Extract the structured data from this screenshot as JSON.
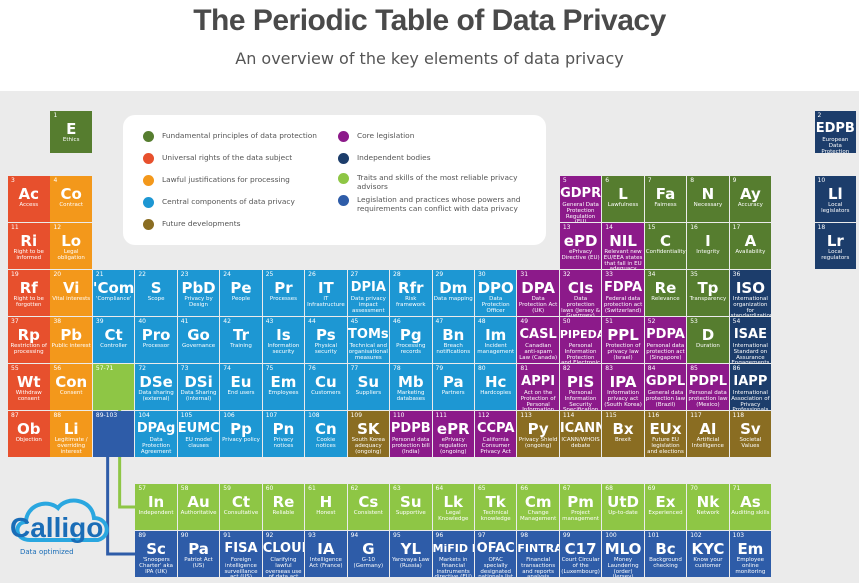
{
  "title": "The Periodic Table of Data Privacy",
  "subtitle": "An overview of the key elements of data privacy",
  "colors": {
    "fundamental": "#567d2f",
    "rights": "#e7502d",
    "lawful": "#f3981b",
    "central": "#1d97d3",
    "future": "#8a6d22",
    "core_legislation": "#8c1a8a",
    "independent_bodies": "#1c3d6b",
    "traits": "#8ec645",
    "conflicting": "#2e5ca8",
    "placeholder_lanthanide": "#8ec645",
    "placeholder_actinide": "#2e5ca8"
  },
  "legend": [
    {
      "key": "fundamental",
      "label": "Fundamental principles of data protection"
    },
    {
      "key": "rights",
      "label": "Universal rights of the data subject"
    },
    {
      "key": "lawful",
      "label": "Lawful justifications for processing"
    },
    {
      "key": "central",
      "label": "Central components of data privacy"
    },
    {
      "key": "future",
      "label": "Future developments"
    },
    {
      "key": "core_legislation",
      "label": "Core legislation"
    },
    {
      "key": "independent_bodies",
      "label": "Independent bodies"
    },
    {
      "key": "traits",
      "label": "Traits and skills of the most reliable privacy advisors"
    },
    {
      "key": "conflicting",
      "label": "Legislation and practices whose powers and requirements can conflict with data privacy"
    }
  ],
  "elements": [
    {
      "n": "1",
      "s": "E",
      "d": "Ethics",
      "c": "fundamental",
      "row": 0,
      "col": 1
    },
    {
      "n": "2",
      "s": "EDPB",
      "d": "European Data Protection Board",
      "c": "independent_bodies",
      "row": 0,
      "col": 19
    },
    {
      "n": "3",
      "s": "Ac",
      "d": "Access",
      "c": "rights",
      "row": 1,
      "col": 0
    },
    {
      "n": "4",
      "s": "Co",
      "d": "Contract",
      "c": "lawful",
      "row": 1,
      "col": 1
    },
    {
      "n": "5",
      "s": "GDPR",
      "d": "General Data Protection Regulation (EU)",
      "c": "core_legislation",
      "row": 1,
      "col": 13
    },
    {
      "n": "6",
      "s": "L",
      "d": "Lawfulness",
      "c": "fundamental",
      "row": 1,
      "col": 14
    },
    {
      "n": "7",
      "s": "Fa",
      "d": "Fairness",
      "c": "fundamental",
      "row": 1,
      "col": 15
    },
    {
      "n": "8",
      "s": "N",
      "d": "Necessary",
      "c": "fundamental",
      "row": 1,
      "col": 16
    },
    {
      "n": "9",
      "s": "Ay",
      "d": "Accuracy",
      "c": "fundamental",
      "row": 1,
      "col": 17
    },
    {
      "n": "10",
      "s": "Ll",
      "d": "Local legislators",
      "c": "independent_bodies",
      "row": 1,
      "col": 19
    },
    {
      "n": "11",
      "s": "Ri",
      "d": "Right to be informed",
      "c": "rights",
      "row": 2,
      "col": 0
    },
    {
      "n": "12",
      "s": "Lo",
      "d": "Legal obligation",
      "c": "lawful",
      "row": 2,
      "col": 1
    },
    {
      "n": "13",
      "s": "ePD",
      "d": "ePrivacy Directive (EU)",
      "c": "core_legislation",
      "row": 2,
      "col": 13
    },
    {
      "n": "14",
      "s": "NIL",
      "d": "Relevant new EU/EEA states that fall in EU adequacy (Norway, Iceland, Liechtenstein)",
      "c": "core_legislation",
      "row": 2,
      "col": 14
    },
    {
      "n": "15",
      "s": "C",
      "d": "Confidentiality",
      "c": "fundamental",
      "row": 2,
      "col": 15
    },
    {
      "n": "16",
      "s": "I",
      "d": "Integrity",
      "c": "fundamental",
      "row": 2,
      "col": 16
    },
    {
      "n": "17",
      "s": "A",
      "d": "Availability",
      "c": "fundamental",
      "row": 2,
      "col": 17
    },
    {
      "n": "18",
      "s": "Lr",
      "d": "Local regulators",
      "c": "independent_bodies",
      "row": 2,
      "col": 19
    },
    {
      "n": "19",
      "s": "Rf",
      "d": "Right to be forgotten",
      "c": "rights",
      "row": 3,
      "col": 0
    },
    {
      "n": "20",
      "s": "Vi",
      "d": "Vital interests",
      "c": "lawful",
      "row": 3,
      "col": 1
    },
    {
      "n": "21",
      "s": "'Com'",
      "d": "'Compliance'",
      "c": "central",
      "row": 3,
      "col": 2
    },
    {
      "n": "22",
      "s": "S",
      "d": "Scope",
      "c": "central",
      "row": 3,
      "col": 3
    },
    {
      "n": "23",
      "s": "PbD",
      "d": "Privacy by Design",
      "c": "central",
      "row": 3,
      "col": 4
    },
    {
      "n": "24",
      "s": "Pe",
      "d": "People",
      "c": "central",
      "row": 3,
      "col": 5
    },
    {
      "n": "25",
      "s": "Pr",
      "d": "Processes",
      "c": "central",
      "row": 3,
      "col": 6
    },
    {
      "n": "26",
      "s": "IT",
      "d": "IT Infrastructure",
      "c": "central",
      "row": 3,
      "col": 7
    },
    {
      "n": "27",
      "s": "DPIA",
      "d": "Data privacy impact assessment",
      "c": "central",
      "row": 3,
      "col": 8
    },
    {
      "n": "28",
      "s": "Rfr",
      "d": "Risk framework",
      "c": "central",
      "row": 3,
      "col": 9
    },
    {
      "n": "29",
      "s": "Dm",
      "d": "Data mapping",
      "c": "central",
      "row": 3,
      "col": 10
    },
    {
      "n": "30",
      "s": "DPO",
      "d": "Data Protection Officer",
      "c": "central",
      "row": 3,
      "col": 11
    },
    {
      "n": "31",
      "s": "DPA",
      "d": "Data Protection Act (UK)",
      "c": "core_legislation",
      "row": 3,
      "col": 12
    },
    {
      "n": "32",
      "s": "CIs",
      "d": "Data protection laws (Jersey & Guernsey)",
      "c": "core_legislation",
      "row": 3,
      "col": 13
    },
    {
      "n": "33",
      "s": "FDPA",
      "d": "Federal data protection act (Switzerland)",
      "c": "core_legislation",
      "row": 3,
      "col": 14
    },
    {
      "n": "34",
      "s": "Re",
      "d": "Relevance",
      "c": "fundamental",
      "row": 3,
      "col": 15
    },
    {
      "n": "35",
      "s": "Tp",
      "d": "Transparency",
      "c": "fundamental",
      "row": 3,
      "col": 16
    },
    {
      "n": "36",
      "s": "ISO",
      "d": "International organization for standardization",
      "c": "independent_bodies",
      "row": 3,
      "col": 17
    },
    {
      "n": "37",
      "s": "Rp",
      "d": "Restriction of processing",
      "c": "rights",
      "row": 4,
      "col": 0
    },
    {
      "n": "38",
      "s": "Pb",
      "d": "Public interest",
      "c": "lawful",
      "row": 4,
      "col": 1
    },
    {
      "n": "39",
      "s": "Ct",
      "d": "Controller",
      "c": "central",
      "row": 4,
      "col": 2
    },
    {
      "n": "40",
      "s": "Pro",
      "d": "Processor",
      "c": "central",
      "row": 4,
      "col": 3
    },
    {
      "n": "41",
      "s": "Go",
      "d": "Governance",
      "c": "central",
      "row": 4,
      "col": 4
    },
    {
      "n": "42",
      "s": "Tr",
      "d": "Training",
      "c": "central",
      "row": 4,
      "col": 5
    },
    {
      "n": "43",
      "s": "Is",
      "d": "Information security",
      "c": "central",
      "row": 4,
      "col": 6
    },
    {
      "n": "44",
      "s": "Ps",
      "d": "Physical security",
      "c": "central",
      "row": 4,
      "col": 7
    },
    {
      "n": "45",
      "s": "TOMs",
      "d": "Technical and organisational measures",
      "c": "central",
      "row": 4,
      "col": 8
    },
    {
      "n": "46",
      "s": "Pg",
      "d": "Processing records",
      "c": "central",
      "row": 4,
      "col": 9
    },
    {
      "n": "47",
      "s": "Bn",
      "d": "Breach notifications",
      "c": "central",
      "row": 4,
      "col": 10
    },
    {
      "n": "48",
      "s": "Im",
      "d": "Incident management",
      "c": "central",
      "row": 4,
      "col": 11
    },
    {
      "n": "49",
      "s": "CASL",
      "d": "Canadian anti-spam Law (Canada)",
      "c": "core_legislation",
      "row": 4,
      "col": 12
    },
    {
      "n": "50",
      "s": "PIPEDA",
      "d": "Personal Information Protection and Electronic Documents Act (Canada)",
      "c": "core_legislation",
      "row": 4,
      "col": 13
    },
    {
      "n": "51",
      "s": "PPL",
      "d": "Protection of privacy law (Israel)",
      "c": "core_legislation",
      "row": 4,
      "col": 14
    },
    {
      "n": "52",
      "s": "PDPA",
      "d": "Personal data protection act (Singapore)",
      "c": "core_legislation",
      "row": 4,
      "col": 15
    },
    {
      "n": "53",
      "s": "D",
      "d": "Duration",
      "c": "fundamental",
      "row": 4,
      "col": 16
    },
    {
      "n": "54",
      "s": "ISAE",
      "d": "International Standard on Assurance Engagements",
      "c": "independent_bodies",
      "row": 4,
      "col": 17
    },
    {
      "n": "55",
      "s": "Wt",
      "d": "Withdraw consent",
      "c": "rights",
      "row": 5,
      "col": 0
    },
    {
      "n": "56",
      "s": "Con",
      "d": "Consent",
      "c": "lawful",
      "row": 5,
      "col": 1
    },
    {
      "n": "72",
      "s": "DSe",
      "d": "Data sharing (external)",
      "c": "central",
      "row": 5,
      "col": 3
    },
    {
      "n": "73",
      "s": "DSi",
      "d": "Data Sharing (internal)",
      "c": "central",
      "row": 5,
      "col": 4
    },
    {
      "n": "74",
      "s": "Eu",
      "d": "End users",
      "c": "central",
      "row": 5,
      "col": 5
    },
    {
      "n": "75",
      "s": "Em",
      "d": "Employees",
      "c": "central",
      "row": 5,
      "col": 6
    },
    {
      "n": "76",
      "s": "Cu",
      "d": "Customers",
      "c": "central",
      "row": 5,
      "col": 7
    },
    {
      "n": "77",
      "s": "Su",
      "d": "Suppliers",
      "c": "central",
      "row": 5,
      "col": 8
    },
    {
      "n": "78",
      "s": "Mb",
      "d": "Marketing databases",
      "c": "central",
      "row": 5,
      "col": 9
    },
    {
      "n": "79",
      "s": "Pa",
      "d": "Partners",
      "c": "central",
      "row": 5,
      "col": 10
    },
    {
      "n": "80",
      "s": "Hc",
      "d": "Hardcopies",
      "c": "central",
      "row": 5,
      "col": 11
    },
    {
      "n": "81",
      "s": "APPI",
      "d": "Act on the Protection of Personal Information (Japan)",
      "c": "core_legislation",
      "row": 5,
      "col": 12
    },
    {
      "n": "82",
      "s": "PIS",
      "d": "Personal Information Security Specification (China)",
      "c": "core_legislation",
      "row": 5,
      "col": 13
    },
    {
      "n": "83",
      "s": "IPA",
      "d": "Information privacy act (South Korea)",
      "c": "core_legislation",
      "row": 5,
      "col": 14
    },
    {
      "n": "84",
      "s": "GDPL",
      "d": "General data protection law (Brazil)",
      "c": "core_legislation",
      "row": 5,
      "col": 15
    },
    {
      "n": "85",
      "s": "PDPL",
      "d": "Personal data protection law (Mexico)",
      "c": "core_legislation",
      "row": 5,
      "col": 16
    },
    {
      "n": "86",
      "s": "IAPP",
      "d": "International Association of Privacy Professionals",
      "c": "independent_bodies",
      "row": 5,
      "col": 17
    },
    {
      "n": "87",
      "s": "Ob",
      "d": "Objection",
      "c": "rights",
      "row": 6,
      "col": 0
    },
    {
      "n": "88",
      "s": "Li",
      "d": "Legitimate / overriding interest",
      "c": "lawful",
      "row": 6,
      "col": 1
    },
    {
      "n": "104",
      "s": "DPAg",
      "d": "Data Protection Agreement",
      "c": "central",
      "row": 6,
      "col": 3
    },
    {
      "n": "105",
      "s": "EUMC",
      "d": "EU model clauses",
      "c": "central",
      "row": 6,
      "col": 4
    },
    {
      "n": "106",
      "s": "Pp",
      "d": "Privacy policy",
      "c": "central",
      "row": 6,
      "col": 5
    },
    {
      "n": "107",
      "s": "Pn",
      "d": "Privacy notices",
      "c": "central",
      "row": 6,
      "col": 6
    },
    {
      "n": "108",
      "s": "Cn",
      "d": "Cookie notices",
      "c": "central",
      "row": 6,
      "col": 7
    },
    {
      "n": "109",
      "s": "SK",
      "d": "South Korea adequacy (ongoing)",
      "c": "future",
      "row": 6,
      "col": 8
    },
    {
      "n": "110",
      "s": "PDPB",
      "d": "Personal data protection bill (India)",
      "c": "core_legislation",
      "row": 6,
      "col": 9
    },
    {
      "n": "111",
      "s": "ePR",
      "d": "ePrivacy regulation (ongoing)",
      "c": "core_legislation",
      "row": 6,
      "col": 10
    },
    {
      "n": "112",
      "s": "CCPA",
      "d": "California Consumer Privacy Act",
      "c": "core_legislation",
      "row": 6,
      "col": 11
    },
    {
      "n": "113",
      "s": "Py",
      "d": "Privacy Shield (ongoing)",
      "c": "future",
      "row": 6,
      "col": 12
    },
    {
      "n": "114",
      "s": "ICANN",
      "d": "ICANN/WHOIS debate",
      "c": "future",
      "row": 6,
      "col": 13
    },
    {
      "n": "115",
      "s": "Bx",
      "d": "Brexit",
      "c": "future",
      "row": 6,
      "col": 14
    },
    {
      "n": "116",
      "s": "EUx",
      "d": "Future EU legislation and elections",
      "c": "future",
      "row": 6,
      "col": 15
    },
    {
      "n": "117",
      "s": "AI",
      "d": "Artificial Intelligence",
      "c": "future",
      "row": 6,
      "col": 16
    },
    {
      "n": "118",
      "s": "Sv",
      "d": "Societal Values",
      "c": "future",
      "row": 6,
      "col": 17
    },
    {
      "n": "57",
      "s": "In",
      "d": "Independent",
      "c": "traits",
      "row": 8,
      "col": 3
    },
    {
      "n": "58",
      "s": "Au",
      "d": "Authoritative",
      "c": "traits",
      "row": 8,
      "col": 4
    },
    {
      "n": "59",
      "s": "Ct",
      "d": "Consultative",
      "c": "traits",
      "row": 8,
      "col": 5
    },
    {
      "n": "60",
      "s": "Re",
      "d": "Reliable",
      "c": "traits",
      "row": 8,
      "col": 6
    },
    {
      "n": "61",
      "s": "H",
      "d": "Honest",
      "c": "traits",
      "row": 8,
      "col": 7
    },
    {
      "n": "62",
      "s": "Cs",
      "d": "Consistent",
      "c": "traits",
      "row": 8,
      "col": 8
    },
    {
      "n": "63",
      "s": "Su",
      "d": "Supportive",
      "c": "traits",
      "row": 8,
      "col": 9
    },
    {
      "n": "64",
      "s": "Lk",
      "d": "Legal Knowledge",
      "c": "traits",
      "row": 8,
      "col": 10
    },
    {
      "n": "65",
      "s": "Tk",
      "d": "Technical knowledge",
      "c": "traits",
      "row": 8,
      "col": 11
    },
    {
      "n": "66",
      "s": "Cm",
      "d": "Change Management",
      "c": "traits",
      "row": 8,
      "col": 12
    },
    {
      "n": "67",
      "s": "Pm",
      "d": "Project management",
      "c": "traits",
      "row": 8,
      "col": 13
    },
    {
      "n": "68",
      "s": "UtD",
      "d": "Up-to-date",
      "c": "traits",
      "row": 8,
      "col": 14
    },
    {
      "n": "69",
      "s": "Ex",
      "d": "Experienced",
      "c": "traits",
      "row": 8,
      "col": 15
    },
    {
      "n": "70",
      "s": "Nk",
      "d": "Network",
      "c": "traits",
      "row": 8,
      "col": 16
    },
    {
      "n": "71",
      "s": "As",
      "d": "Auditing skills",
      "c": "traits",
      "row": 8,
      "col": 17
    },
    {
      "n": "89",
      "s": "Sc",
      "d": "'Snoopers Charter' aka IPA (UK)",
      "c": "conflicting",
      "row": 9,
      "col": 3
    },
    {
      "n": "90",
      "s": "Pa",
      "d": "Patriot Act (US)",
      "c": "conflicting",
      "row": 9,
      "col": 4
    },
    {
      "n": "91",
      "s": "FISA",
      "d": "Foreign intelligence surveillance act (US)",
      "c": "conflicting",
      "row": 9,
      "col": 5
    },
    {
      "n": "92",
      "s": "CLOUD",
      "d": "Clarifying lawful overseas use of data act (US)",
      "c": "conflicting",
      "row": 9,
      "col": 6
    },
    {
      "n": "93",
      "s": "IA",
      "d": "Intelligence Act (France)",
      "c": "conflicting",
      "row": 9,
      "col": 7
    },
    {
      "n": "94",
      "s": "G",
      "d": "G-10 (Germany)",
      "c": "conflicting",
      "row": 9,
      "col": 8
    },
    {
      "n": "95",
      "s": "YL",
      "d": "Yarovaya Law (Russia)",
      "c": "conflicting",
      "row": 9,
      "col": 9
    },
    {
      "n": "96",
      "s": "MiFID II",
      "d": "Markets in financial instruments directive (EU)",
      "c": "conflicting",
      "row": 9,
      "col": 10
    },
    {
      "n": "97",
      "s": "OFAC",
      "d": "OFAC specially designated nationals list (US)",
      "c": "conflicting",
      "row": 9,
      "col": 11
    },
    {
      "n": "98",
      "s": "FINTRAC",
      "d": "Financial transactions and reports analysis centre (Canada)",
      "c": "conflicting",
      "row": 9,
      "col": 12
    },
    {
      "n": "99",
      "s": "C17",
      "d": "Court Circular of the (Luxembourg)",
      "c": "conflicting",
      "row": 9,
      "col": 13
    },
    {
      "n": "100",
      "s": "MLO",
      "d": "Money Laundering (order) (Jersey)",
      "c": "conflicting",
      "row": 9,
      "col": 14
    },
    {
      "n": "101",
      "s": "Bc",
      "d": "Background checking",
      "c": "conflicting",
      "row": 9,
      "col": 15
    },
    {
      "n": "102",
      "s": "KYC",
      "d": "Know your customer",
      "c": "conflicting",
      "row": 9,
      "col": 16
    },
    {
      "n": "103",
      "s": "Em",
      "d": "Employee online monitoring",
      "c": "conflicting",
      "row": 9,
      "col": 17
    }
  ],
  "placeholders": [
    {
      "n": "57-71",
      "c": "placeholder_lanthanide",
      "row": 5,
      "col": 2
    },
    {
      "n": "89-103",
      "c": "placeholder_actinide",
      "row": 6,
      "col": 2
    }
  ],
  "logo": {
    "name": "Calligo",
    "tagline": "Data optimized"
  }
}
